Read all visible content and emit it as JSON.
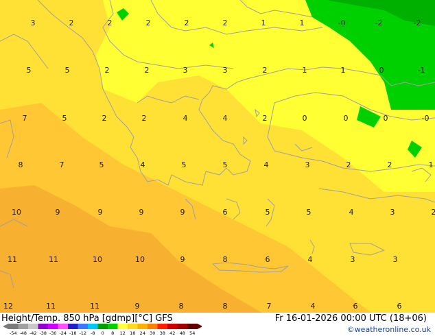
{
  "map": {
    "title": "Height/Temp. 850 hPa [gdmp][°C] GFS",
    "valid_time": "Fr 16-01-2026 00:00 UTC (18+06)",
    "credit": "©weatheronline.co.uk",
    "grid_values": [
      {
        "v": "3"
      },
      {
        "v": "2"
      },
      {
        "v": "2"
      },
      {
        "v": "2"
      },
      {
        "v": "2"
      },
      {
        "v": "2"
      },
      {
        "v": "1"
      },
      {
        "v": "1"
      },
      {
        "v": "-0"
      },
      {
        "v": "-2"
      },
      {
        "v": "-2"
      },
      {
        "v": "5"
      },
      {
        "v": "5"
      },
      {
        "v": "2"
      },
      {
        "v": "2"
      },
      {
        "v": "3"
      },
      {
        "v": "3"
      },
      {
        "v": "2"
      },
      {
        "v": "1"
      },
      {
        "v": "1"
      },
      {
        "v": "0"
      },
      {
        "v": "-1"
      },
      {
        "v": "7"
      },
      {
        "v": "5"
      },
      {
        "v": "2"
      },
      {
        "v": "2"
      },
      {
        "v": "4"
      },
      {
        "v": "4"
      },
      {
        "v": "2"
      },
      {
        "v": "0"
      },
      {
        "v": "0"
      },
      {
        "v": "0"
      },
      {
        "v": "-0"
      },
      {
        "v": "8"
      },
      {
        "v": "7"
      },
      {
        "v": "5"
      },
      {
        "v": "4"
      },
      {
        "v": "5"
      },
      {
        "v": "5"
      },
      {
        "v": "4"
      },
      {
        "v": "3"
      },
      {
        "v": "2"
      },
      {
        "v": "2"
      },
      {
        "v": "1"
      },
      {
        "v": "10"
      },
      {
        "v": "9"
      },
      {
        "v": "9"
      },
      {
        "v": "9"
      },
      {
        "v": "9"
      },
      {
        "v": "6"
      },
      {
        "v": "5"
      },
      {
        "v": "5"
      },
      {
        "v": "4"
      },
      {
        "v": "3"
      },
      {
        "v": "2"
      },
      {
        "v": "11"
      },
      {
        "v": "11"
      },
      {
        "v": "10"
      },
      {
        "v": "10"
      },
      {
        "v": "9"
      },
      {
        "v": "8"
      },
      {
        "v": "6"
      },
      {
        "v": "4"
      },
      {
        "v": "3"
      },
      {
        "v": "3"
      },
      {
        "v": "12"
      },
      {
        "v": "11"
      },
      {
        "v": "11"
      },
      {
        "v": "9"
      },
      {
        "v": "8"
      },
      {
        "v": "8"
      },
      {
        "v": "7"
      },
      {
        "v": "4"
      },
      {
        "v": "6"
      },
      {
        "v": "6"
      }
    ],
    "legend_ticks": [
      "-54",
      "-48",
      "-42",
      "-38",
      "-30",
      "-24",
      "-18",
      "-12",
      "-8",
      "0",
      "8",
      "12",
      "18",
      "24",
      "30",
      "38",
      "42",
      "48",
      "54"
    ],
    "legend_colors": [
      "#7a7a7a",
      "#a0a0a0",
      "#c8c8c8",
      "#9400d3",
      "#d000ff",
      "#ff50ff",
      "#2020c8",
      "#3c78ff",
      "#00c8ff",
      "#00a000",
      "#00d000",
      "#ffff40",
      "#ffd820",
      "#ffb000",
      "#ff8000",
      "#ff2000",
      "#d00000",
      "#a00000",
      "#600000"
    ],
    "colors": {
      "band_cold": "#00d000",
      "band_0_4": "#ffff33",
      "band_4_8": "#ffe135",
      "band_8_12": "#ffc733",
      "band_12_16": "#f7b030",
      "coast": "#a0a0a0"
    }
  }
}
